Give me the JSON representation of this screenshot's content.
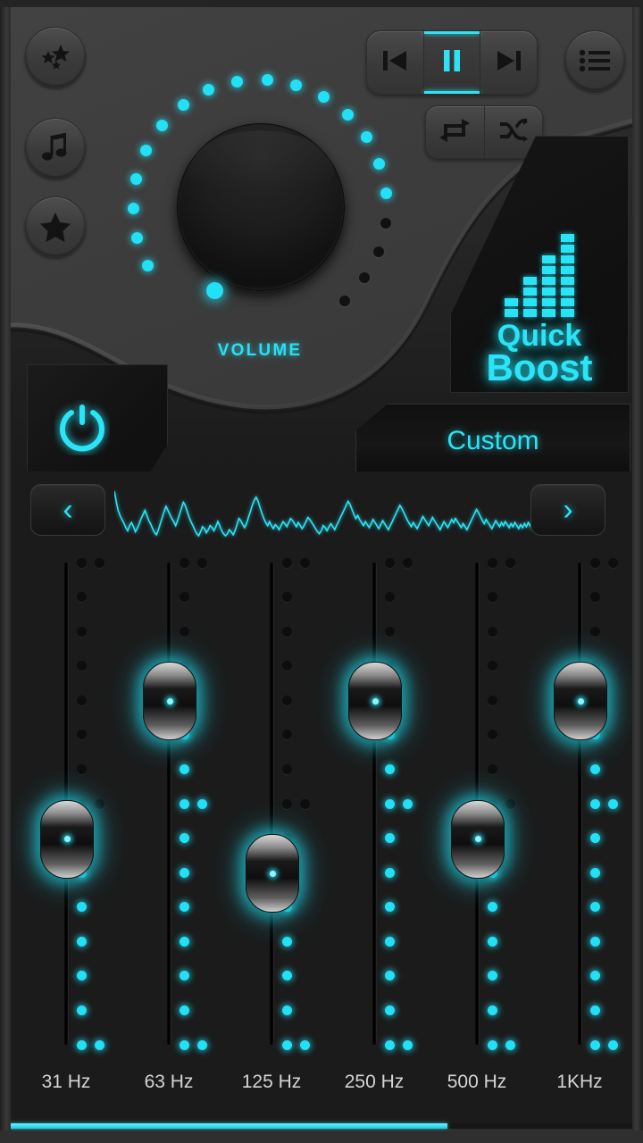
{
  "app": {
    "title": "Equalizer",
    "accent_color": "#22e0f5",
    "panel_color": "#3a3a3a",
    "dark_color": "#1b1b1b"
  },
  "side_buttons": [
    {
      "name": "effects-button",
      "icon": "sparkles-icon"
    },
    {
      "name": "music-button",
      "icon": "music-note-icon"
    },
    {
      "name": "favorite-button",
      "icon": "star-icon"
    }
  ],
  "transport": {
    "previous_label": "Previous",
    "play_pause_label": "Pause",
    "next_label": "Next",
    "play_state": "playing",
    "repeat_label": "Repeat",
    "shuffle_label": "Shuffle",
    "playlist_label": "Playlist"
  },
  "volume": {
    "label": "VOLUME",
    "total_steps": 20,
    "lit_steps": 16,
    "indicator_angle_deg": 118
  },
  "power": {
    "label": "Power",
    "state": "on"
  },
  "quick_boost": {
    "line1": "Quick",
    "line2": "Boost",
    "bars": [
      2,
      4,
      6,
      8
    ],
    "bar_max": 8
  },
  "preset": {
    "label": "Custom",
    "prev_label": "‹",
    "next_label": "›"
  },
  "waveform": {
    "points": [
      98,
      78,
      60,
      50,
      42,
      35,
      26,
      20,
      30,
      36,
      28,
      18,
      25,
      34,
      44,
      52,
      60,
      50,
      40,
      33,
      24,
      16,
      12,
      22,
      34,
      46,
      58,
      68,
      60,
      52,
      44,
      38,
      30,
      40,
      52,
      64,
      76,
      70,
      58,
      47,
      38,
      30,
      22,
      14,
      10,
      18,
      28,
      24,
      16,
      22,
      30,
      26,
      20,
      28,
      38,
      30,
      20,
      14,
      10,
      14,
      22,
      18,
      12,
      20,
      32,
      44,
      40,
      32,
      26,
      34,
      46,
      58,
      70,
      80,
      86,
      78,
      66,
      54,
      44,
      36,
      30,
      38,
      30,
      24,
      32,
      28,
      22,
      30,
      38,
      34,
      28,
      36,
      44,
      40,
      34,
      28,
      36,
      30,
      24,
      30,
      38,
      46,
      42,
      36,
      30,
      24,
      18,
      14,
      20,
      30,
      26,
      20,
      28,
      34,
      28,
      22,
      30,
      38,
      46,
      54,
      62,
      70,
      78,
      72,
      62,
      52,
      44,
      50,
      42,
      36,
      30,
      38,
      32,
      26,
      34,
      42,
      36,
      30,
      24,
      32,
      40,
      34,
      28,
      22,
      30,
      38,
      46,
      54,
      62,
      70,
      64,
      56,
      48,
      40,
      34,
      28,
      36,
      30,
      24,
      32,
      40,
      48,
      42,
      36,
      30,
      38,
      46,
      40,
      34,
      28,
      22,
      30,
      38,
      32,
      26,
      34,
      42,
      36,
      44,
      38,
      32,
      26,
      34,
      28,
      22,
      30,
      38,
      46,
      54,
      62,
      56,
      48,
      40,
      34,
      42,
      36,
      30,
      24,
      32,
      40,
      34,
      28,
      36,
      30,
      38,
      32,
      26,
      34,
      28,
      36,
      30,
      24,
      32,
      26,
      34,
      28,
      36,
      30,
      24,
      32
    ]
  },
  "equalizer": {
    "scale_steps": 15,
    "bands": [
      {
        "freq_label": "31 Hz",
        "value_step": 8,
        "lit_below": 7
      },
      {
        "freq_label": "63 Hz",
        "value_step": 4,
        "lit_below": 11
      },
      {
        "freq_label": "125 Hz",
        "value_step": 9,
        "lit_below": 6
      },
      {
        "freq_label": "250 Hz",
        "value_step": 4,
        "lit_below": 11
      },
      {
        "freq_label": "500 Hz",
        "value_step": 8,
        "lit_below": 7
      },
      {
        "freq_label": "1KHz",
        "value_step": 4,
        "lit_below": 11
      }
    ]
  },
  "scroll": {
    "position_percent": 0,
    "thumb_percent": 70
  }
}
